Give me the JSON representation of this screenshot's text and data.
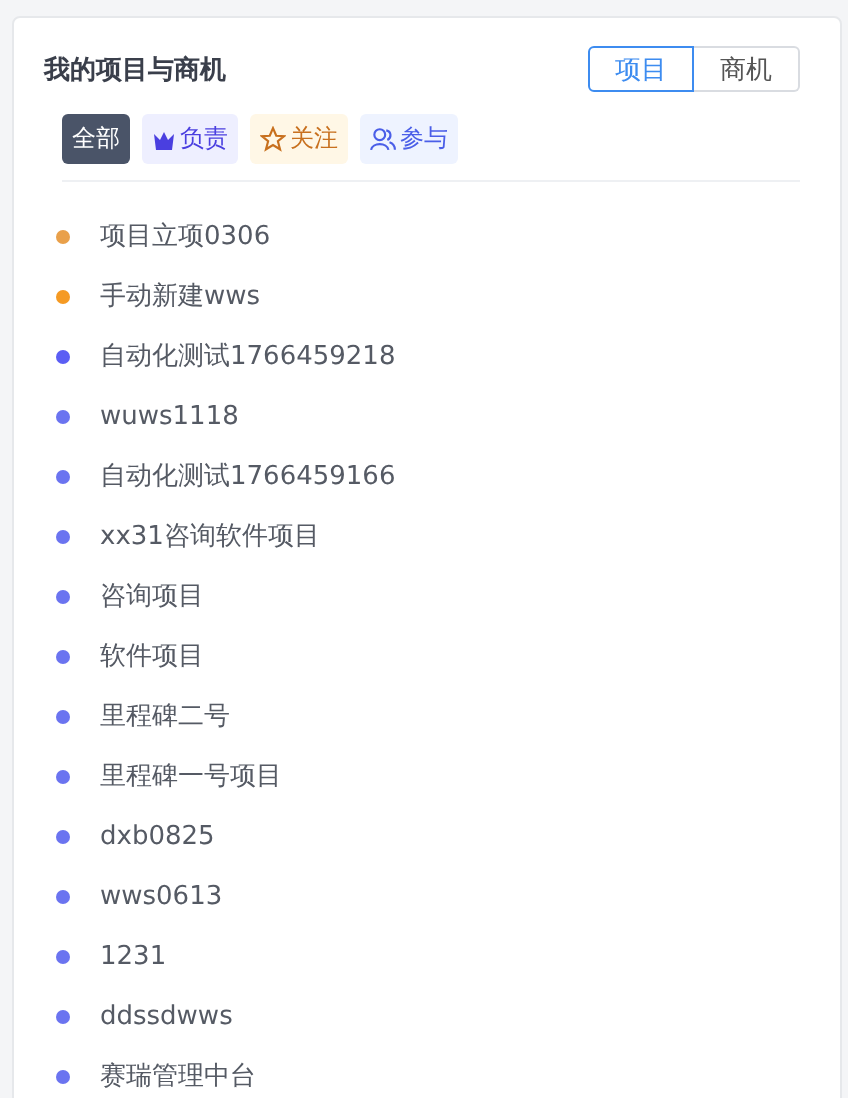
{
  "card": {
    "title": "我的项目与商机"
  },
  "segments": [
    {
      "label": "项目",
      "selected": true
    },
    {
      "label": "商机",
      "selected": false
    }
  ],
  "filters": [
    {
      "label": "全部",
      "kind": "all",
      "selected": true
    },
    {
      "label": "负责",
      "kind": "owner",
      "selected": false
    },
    {
      "label": "关注",
      "kind": "follow",
      "selected": false
    },
    {
      "label": "参与",
      "kind": "join",
      "selected": false
    }
  ],
  "projects": [
    {
      "name": "项目立项0306",
      "color": "#e9a04a"
    },
    {
      "name": "手动新建wws",
      "color": "#f59a23"
    },
    {
      "name": "自动化测试1766459218",
      "color": "#5b5ef4"
    },
    {
      "name": "wuws1118",
      "color": "#6b74f0"
    },
    {
      "name": "自动化测试1766459166",
      "color": "#6b74f0"
    },
    {
      "name": "xx31咨询软件项目",
      "color": "#6b74f0"
    },
    {
      "name": "咨询项目",
      "color": "#6b74f0"
    },
    {
      "name": "软件项目",
      "color": "#6b74f0"
    },
    {
      "name": "里程碑二号",
      "color": "#6b74f0"
    },
    {
      "name": "里程碑一号项目",
      "color": "#6b74f0"
    },
    {
      "name": "dxb0825",
      "color": "#6b74f0"
    },
    {
      "name": "wws0613",
      "color": "#6b74f0"
    },
    {
      "name": "1231",
      "color": "#6b74f0"
    },
    {
      "name": "ddssdwws",
      "color": "#6b74f0"
    },
    {
      "name": "赛瑞管理中台",
      "color": "#6b74f0"
    }
  ]
}
